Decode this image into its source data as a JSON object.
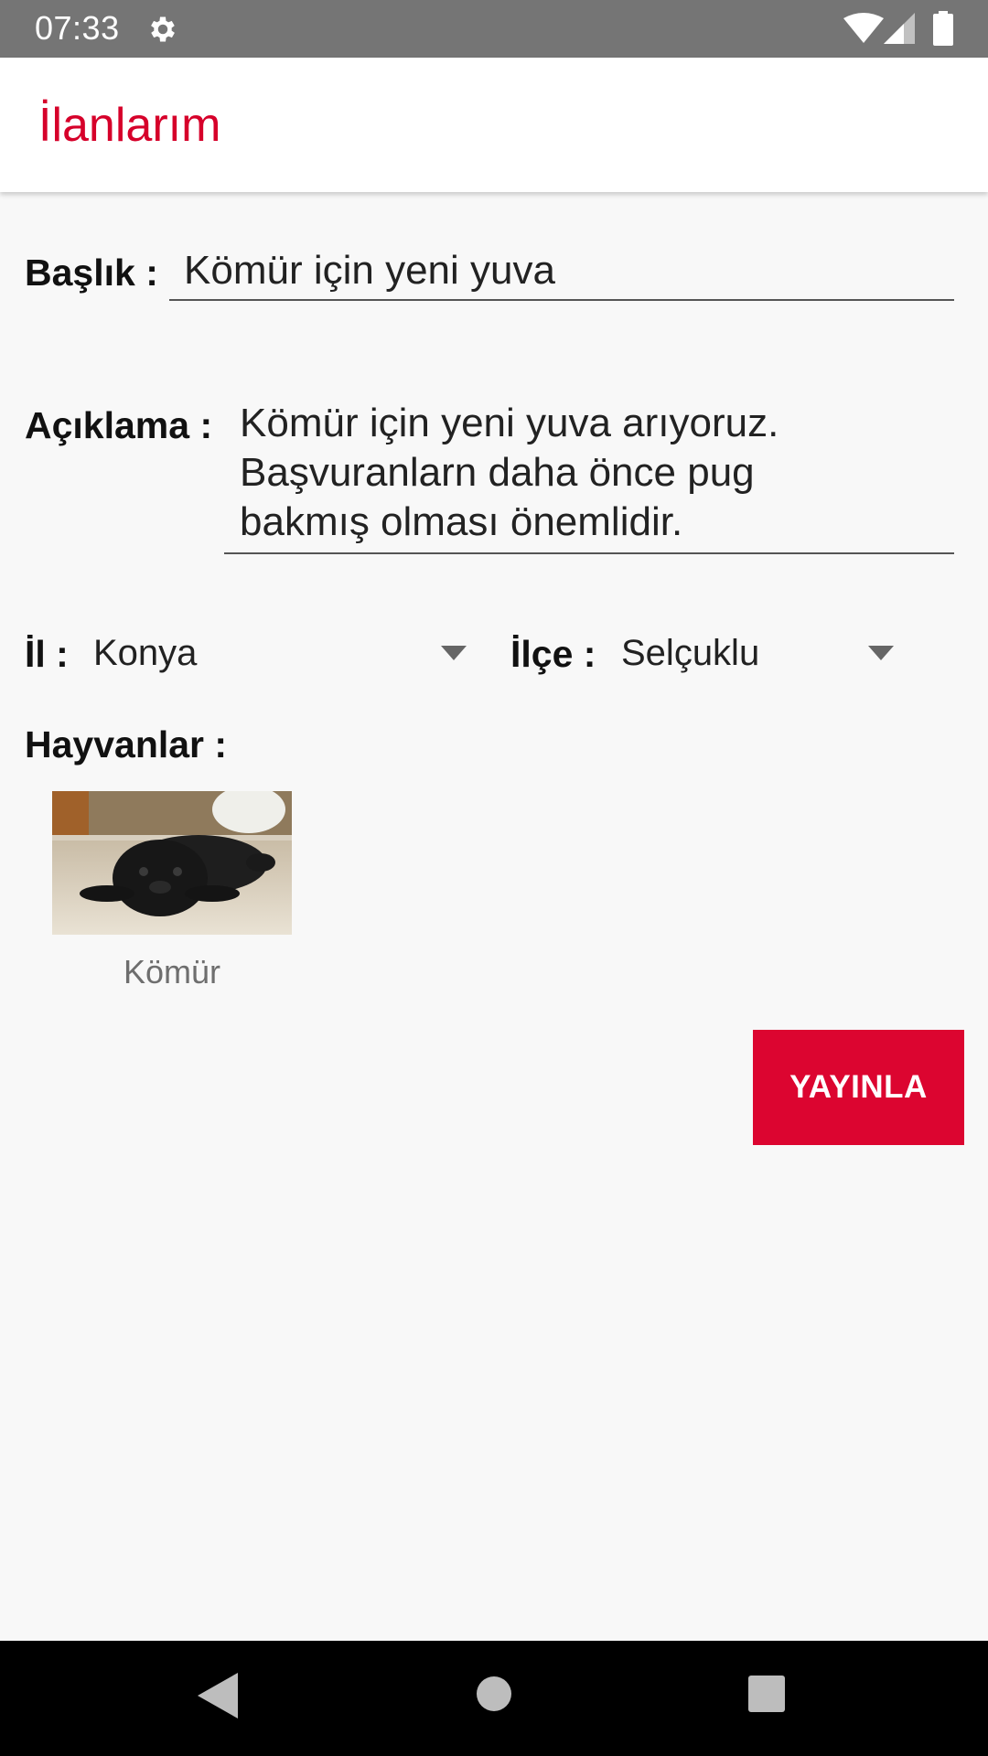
{
  "status_bar": {
    "time": "07:33",
    "icons": [
      "gear-icon",
      "wifi-icon",
      "signal-icon",
      "battery-icon"
    ]
  },
  "app_bar": {
    "title": "İlanlarım",
    "title_color": "#d6002a"
  },
  "form": {
    "title_label": "Başlık :",
    "title_value": "Kömür için yeni yuva",
    "description_label": "Açıklama :",
    "description_value": "Kömür için yeni yuva arıyoruz.\nBaşvuranlarn  daha önce pug\nbakmış olması önemlidir.",
    "province_label": "İl :",
    "province_value": "Konya",
    "district_label": "İlçe :",
    "district_value": "Selçuklu",
    "animals_label": "Hayvanlar :"
  },
  "animals": [
    {
      "name": "Kömür",
      "image": "black-pug-photo"
    }
  ],
  "actions": {
    "publish_label": "YAYINLA",
    "publish_color": "#dc0530"
  },
  "nav_bar": {
    "icons": [
      "back-icon",
      "home-icon",
      "recents-icon"
    ]
  }
}
